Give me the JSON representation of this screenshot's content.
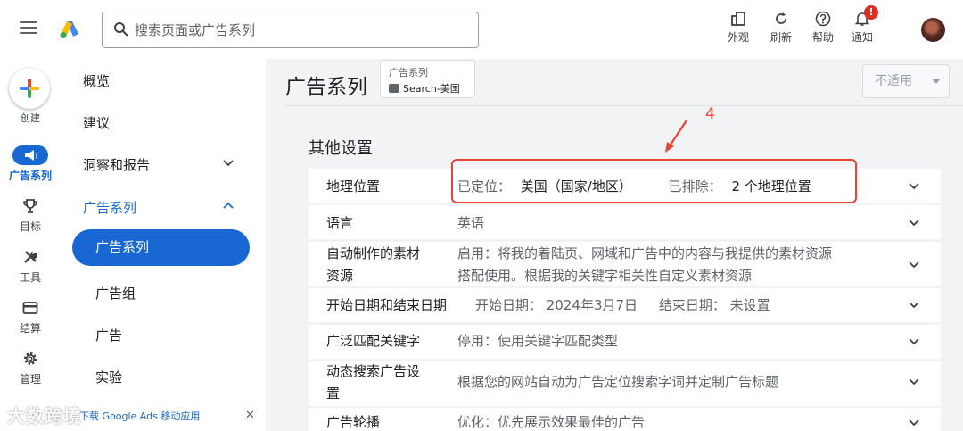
{
  "search": {
    "placeholder": "搜索页面或广告系列"
  },
  "toolbar": [
    {
      "label": "外观",
      "icon": "appearance-icon"
    },
    {
      "label": "刷新",
      "icon": "refresh-icon"
    },
    {
      "label": "帮助",
      "icon": "help-icon"
    },
    {
      "label": "通知",
      "icon": "bell-icon",
      "badge": "!"
    }
  ],
  "rail": {
    "create_label": "创建",
    "items": [
      {
        "label": "广告系列",
        "icon": "megaphone-icon",
        "active": true
      },
      {
        "label": "目标",
        "icon": "trophy-icon"
      },
      {
        "label": "工具",
        "icon": "tools-icon"
      },
      {
        "label": "结算",
        "icon": "billing-icon"
      },
      {
        "label": "管理",
        "icon": "gear-icon"
      }
    ]
  },
  "subnav": {
    "top_items": [
      "概览",
      "建议",
      "洞察和报告"
    ],
    "group_label": "广告系列",
    "group_items": [
      "广告系列",
      "广告组",
      "广告",
      "实验"
    ],
    "promo_text": "下载 Google Ads 移动应用",
    "promo_close": "✕"
  },
  "main": {
    "title": "广告系列",
    "chip": {
      "label": "广告系列",
      "value": "Search-美国"
    },
    "status_button": "不适用",
    "section_title": "其他设置",
    "settings": [
      {
        "label": "地理位置",
        "value_parts": [
          "已定位：",
          "美国（国家/地区）",
          "已排除：",
          "2 个地理位置"
        ]
      },
      {
        "label": "语言",
        "value": "英语"
      },
      {
        "label_line1": "自动制作的素材",
        "label_line2": "资源",
        "value_line1": "启用：将我的着陆页、网域和广告中的内容与我提供的素材资源",
        "value_line2": "搭配使用。根据我的关键字相关性自定义素材资源"
      },
      {
        "label": "开始日期和结束日期",
        "value": "开始日期： 2024年3月7日     结束日期： 未设置"
      },
      {
        "label": "广泛匹配关键字",
        "value": "停用：使用关键字匹配类型"
      },
      {
        "label_line1": "动态搜索广告设",
        "label_line2": "置",
        "value": "根据您的网站自动为广告定位搜索字词并定制广告标题"
      },
      {
        "label": "广告轮播",
        "value": "优化：优先展示效果最佳的广告"
      }
    ]
  },
  "annotation": {
    "number": "4",
    "color": "#ea4335"
  },
  "watermark": "大数跨境",
  "colors": {
    "accent": "#1967d2",
    "background": "#f1f3f4",
    "annotation": "#ea4335"
  }
}
